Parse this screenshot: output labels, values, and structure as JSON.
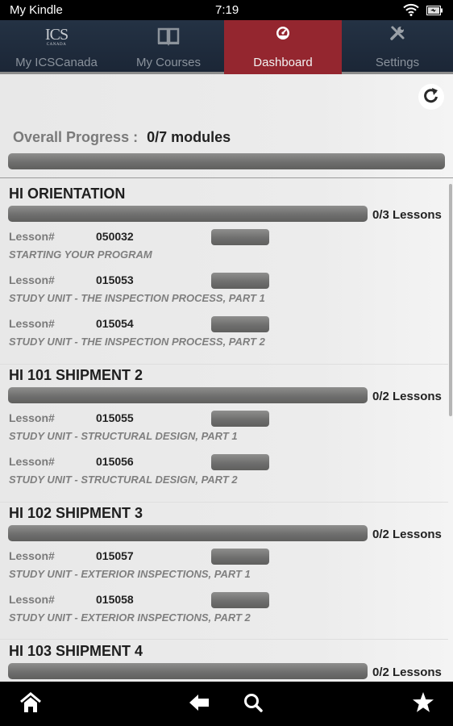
{
  "status_bar": {
    "title": "My Kindle",
    "time": "7:19",
    "icons": [
      "wifi-icon",
      "battery-charging-icon"
    ]
  },
  "tabs": [
    {
      "label": "My ICSCanada",
      "icon": "ics-canada-logo",
      "logo_text": "ICS",
      "logo_subtext": "CANADA",
      "active": false
    },
    {
      "label": "My Courses",
      "icon": "book-icon",
      "active": false
    },
    {
      "label": "Dashboard",
      "icon": "speedometer-icon",
      "active": true
    },
    {
      "label": "Settings",
      "icon": "tools-icon",
      "active": false
    }
  ],
  "colors": {
    "tab_bar": "#1f2b3b",
    "active_tab": "#94262f",
    "progress_bar": "#6f6f6e",
    "background": "#e9e9e9"
  },
  "dashboard": {
    "refresh_icon": "refresh-icon",
    "overall_label": "Overall Progress :",
    "overall_value": "0/7 modules",
    "overall_progress": 0,
    "lesson_label": "Lesson#",
    "modules": [
      {
        "title": "HI ORIENTATION",
        "count": "0/3 Lessons",
        "progress": 0,
        "lessons": [
          {
            "number": "050032",
            "title": "STARTING YOUR PROGRAM",
            "progress": 0
          },
          {
            "number": "015053",
            "title": "STUDY UNIT - THE INSPECTION PROCESS, PART 1",
            "progress": 0
          },
          {
            "number": "015054",
            "title": "STUDY UNIT - THE INSPECTION PROCESS, PART 2",
            "progress": 0
          }
        ]
      },
      {
        "title": "HI 101 SHIPMENT 2",
        "count": "0/2 Lessons",
        "progress": 0,
        "lessons": [
          {
            "number": "015055",
            "title": "STUDY UNIT - STRUCTURAL DESIGN, PART 1",
            "progress": 0
          },
          {
            "number": "015056",
            "title": "STUDY UNIT - STRUCTURAL DESIGN, PART 2",
            "progress": 0
          }
        ]
      },
      {
        "title": "HI 102 SHIPMENT 3",
        "count": "0/2 Lessons",
        "progress": 0,
        "lessons": [
          {
            "number": "015057",
            "title": "STUDY UNIT - EXTERIOR INSPECTIONS, PART 1",
            "progress": 0
          },
          {
            "number": "015058",
            "title": "STUDY UNIT - EXTERIOR INSPECTIONS, PART 2",
            "progress": 0
          }
        ]
      },
      {
        "title": "HI 103 SHIPMENT 4",
        "count": "0/2 Lessons",
        "progress": 0,
        "lessons": []
      }
    ]
  },
  "nav_bar": {
    "buttons": [
      "home-icon",
      "back-arrow-icon",
      "search-icon",
      "star-icon"
    ]
  }
}
